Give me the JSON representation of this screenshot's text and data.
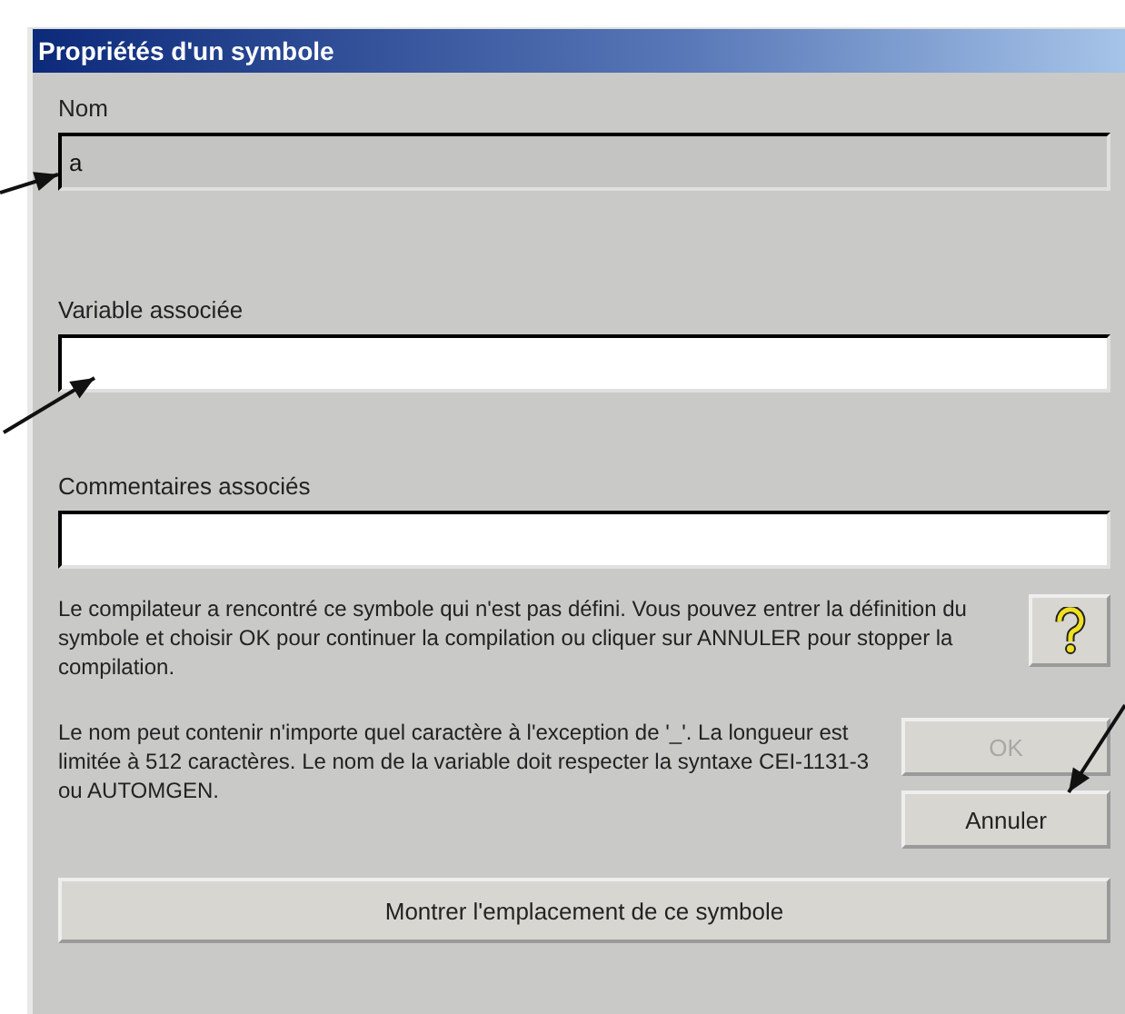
{
  "window": {
    "title": "Propriétés d'un symbole"
  },
  "fields": [
    {
      "label": "Nom",
      "value": "a",
      "disabled": true
    },
    {
      "label": "Variable associée",
      "disabled": false
    },
    {
      "label": "Commentaires associés",
      "disabled": false
    }
  ],
  "messages": [
    "Le compilateur a rencontré ce symbole qui n'est pas défini. Vous pouvez entrer la définition du symbole et choisir OK pour continuer la compilation ou cliquer sur ANNULER pour stopper la compilation.",
    "Le nom peut contenir n'importe quel caractère à l'exception de '_'. La longueur est limitée à 512 caractères. Le nom de la variable doit respecter la syntaxe CEI-1131-3 ou AUTOMGEN."
  ],
  "buttons": [
    {
      "label": "OK",
      "disabled": true
    },
    {
      "label": "Annuler",
      "disabled": false
    }
  ],
  "show_button": {
    "label": "Montrer l'emplacement de ce symbole"
  }
}
